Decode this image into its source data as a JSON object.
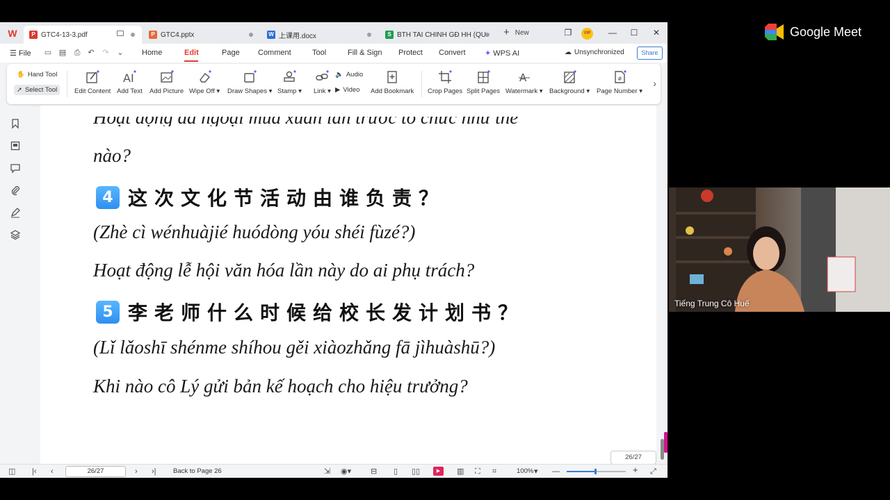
{
  "tabs": [
    {
      "label": "GTC4-13-3.pdf",
      "icon": "pdf",
      "color": "#e03a2f",
      "active": true
    },
    {
      "label": "GTC4.pptx",
      "icon": "P",
      "color": "#e8693a",
      "active": false
    },
    {
      "label": "上课用.docx",
      "icon": "W",
      "color": "#2d6ed8",
      "active": false
    },
    {
      "label": "BTH TAI CHINH GĐ HH (QUẢ",
      "icon": "S",
      "color": "#1e9e52",
      "active": false
    }
  ],
  "new_tab_label": "New",
  "menu": {
    "file": "File",
    "items": [
      "Home",
      "Edit",
      "Page",
      "Comment",
      "Tool",
      "Fill & Sign",
      "Protect",
      "Convert"
    ],
    "active": "Edit",
    "wps_ai": "WPS AI",
    "unsync": "Unsynchronized",
    "share": "Share"
  },
  "toolbar": {
    "hand_tool": "Hand Tool",
    "select_tool": "Select Tool",
    "edit_content": "Edit Content",
    "add_text": "Add Text",
    "add_picture": "Add Picture",
    "wipe_off": "Wipe Off",
    "draw_shapes": "Draw Shapes",
    "stamp": "Stamp",
    "link": "Link",
    "audio": "Audio",
    "video": "Video",
    "add_bookmark": "Add Bookmark",
    "crop_pages": "Crop Pages",
    "split_pages": "Split Pages",
    "watermark": "Watermark",
    "background": "Background",
    "page_number": "Page Number"
  },
  "document": {
    "top_partial": "Hoạt động dã ngoại mùa xuân lần trước tổ chức như thế",
    "top_line2": "nào?",
    "q4_num": "4",
    "q4_cn": "这次文化节活动由谁负责？",
    "q4_pinyin": "(Zhè cì wénhuàjié huódòng yóu shéi fùzé?)",
    "q4_viet": "Hoạt động lễ hội văn hóa lần này do ai phụ trách?",
    "q5_num": "5",
    "q5_cn": "李老师什么时候给校长发计划书？",
    "q5_pinyin": "(Lǐ lǎoshī shénme shíhou gěi xiàozhǎng fā jìhuàshū?)",
    "q5_viet": "Khi nào cô Lý gửi bản kế hoạch cho hiệu trưởng?",
    "page_badge": "26/27"
  },
  "statusbar": {
    "page_input": "26/27",
    "back_to_page": "Back to Page 26",
    "zoom": "100%"
  },
  "meet": {
    "logo_text": "Google Meet",
    "participant_name": "Tiếng Trung Cô Huế"
  }
}
